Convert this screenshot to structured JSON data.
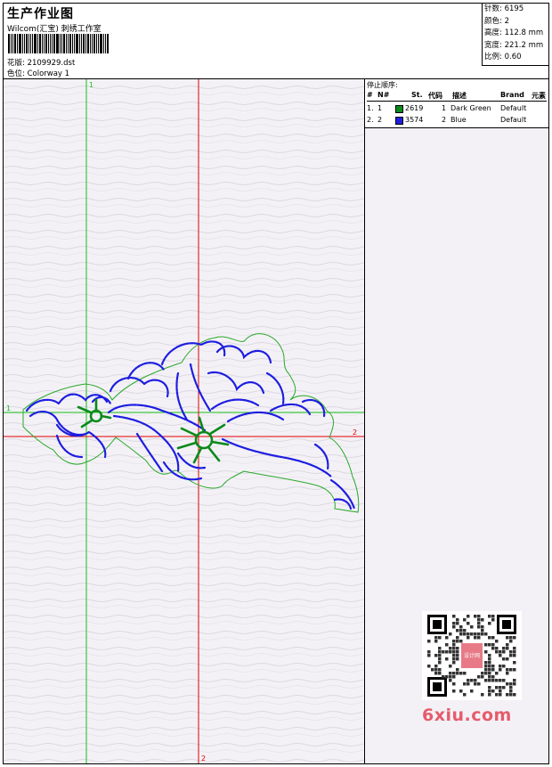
{
  "header": {
    "title": "生产作业图",
    "subtitle": "Wilcom(汇宝) 刺绣工作室",
    "file_label": "花版:",
    "file_value": "2109929.dst",
    "colorway_label": "色位:",
    "colorway_value": "Colorway 1"
  },
  "stats": {
    "stitches_label": "针数:",
    "stitches_value": "6195",
    "colors_label": "颜色:",
    "colors_value": "2",
    "height_label": "高度:",
    "height_value": "112.8 mm",
    "width_label": "宽度:",
    "width_value": "221.2 mm",
    "scale_label": "比例:",
    "scale_value": "0.60"
  },
  "stop_sequence": {
    "title": "停止顺序:",
    "headers": [
      "#",
      "N#",
      "St.",
      "代码",
      "描述",
      "Brand",
      "元素"
    ],
    "rows": [
      {
        "index": "1.",
        "n": "1",
        "stitches": "2619",
        "code": "1",
        "description": "Dark Green",
        "brand": "Default",
        "color": "#0a8a1a"
      },
      {
        "index": "2.",
        "n": "2",
        "stitches": "3574",
        "code": "2",
        "description": "Blue",
        "brand": "Default",
        "color": "#1d1de0"
      }
    ]
  },
  "axes": {
    "v1_top": "1",
    "h1_left": "1",
    "h2_right": "2",
    "v2_bottom": "2"
  },
  "colors": {
    "green_guide": "#16c016",
    "red_guide": "#e00000",
    "thread_green": "#0a8a1a",
    "thread_blue": "#1d1de0",
    "outline_green": "#2aa82a"
  },
  "watermark": {
    "text": "6xiu.com",
    "qr_badge": "设计网"
  }
}
